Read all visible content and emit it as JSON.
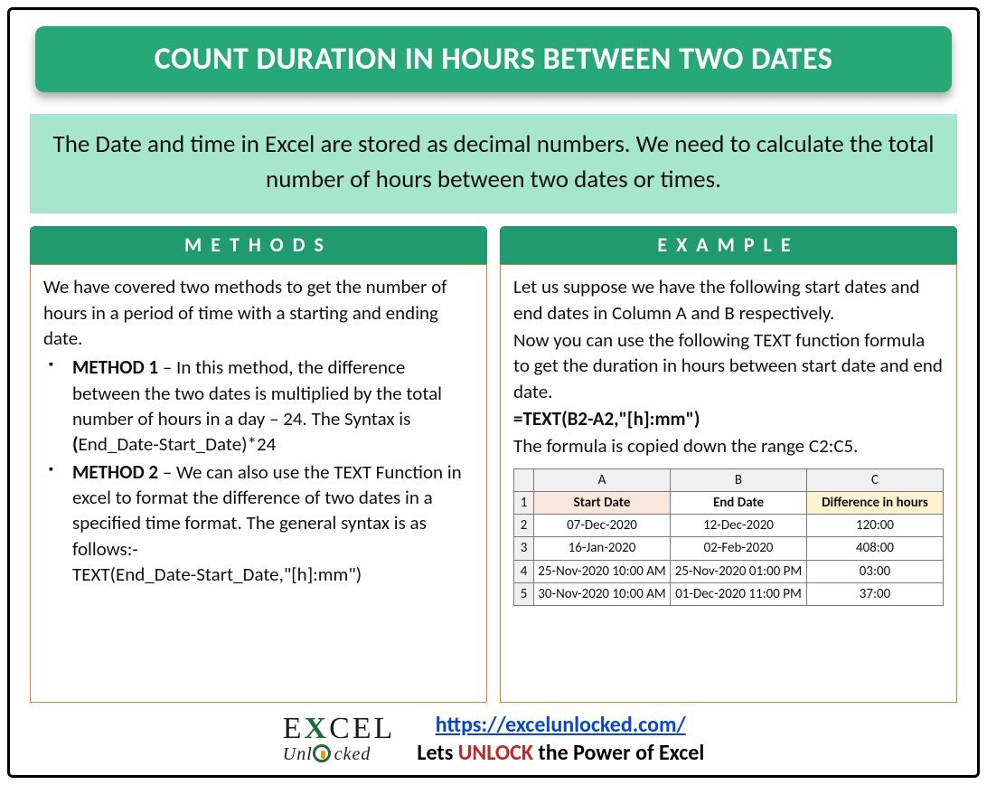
{
  "title": "COUNT DURATION IN HOURS BETWEEN TWO DATES",
  "intro": "The Date and time in Excel are stored as decimal numbers. We need to calculate the total number of hours between two dates or times.",
  "methods": {
    "heading": "METHODS",
    "lead": "We have covered two methods to get the number of hours in a period of time with a starting and ending date.",
    "m1_label": "METHOD 1",
    "m1_text": " – In this method, the difference between the two dates is multiplied by the total number of hours in a day – 24. The Syntax is",
    "m1_syntax_open": "(",
    "m1_syntax_rest": "End_Date-Start_Date)*24",
    "m2_label": "METHOD 2",
    "m2_text": " – We can also use the TEXT Function in excel to format the difference of two dates in a specified time format. The general syntax is as follows:-",
    "m2_syntax": "TEXT(End_Date-Start_Date,\"[h]:mm\")"
  },
  "example": {
    "heading": "EXAMPLE",
    "p1": "Let us suppose we have the following start dates and end dates in Column A and B respectively.",
    "p2": "Now you can use the following TEXT function formula to get the duration in hours between start date and end date.",
    "formula": "=TEXT(B2-A2,\"[h]:mm\")",
    "p3": "The formula is copied down the range C2:C5.",
    "table": {
      "col_letters": [
        "A",
        "B",
        "C"
      ],
      "headers": {
        "start": "Start Date",
        "end": "End Date",
        "diff": "Difference in hours"
      },
      "rows": [
        {
          "n": "2",
          "a": "07-Dec-2020",
          "b": "12-Dec-2020",
          "c": "120:00"
        },
        {
          "n": "3",
          "a": "16-Jan-2020",
          "b": "02-Feb-2020",
          "c": "408:00"
        },
        {
          "n": "4",
          "a": "25-Nov-2020 10:00 AM",
          "b": "25-Nov-2020 01:00 PM",
          "c": "03:00"
        },
        {
          "n": "5",
          "a": "30-Nov-2020 10:00 AM",
          "b": "01-Dec-2020 11:00 PM",
          "c": "37:00"
        }
      ]
    }
  },
  "footer": {
    "logo_top_e1": "E",
    "logo_top_x": "X",
    "logo_top_rest": "CEL",
    "logo_bottom_pre": "Unl",
    "logo_bottom_post": "cked",
    "url": "https://excelunlocked.com/",
    "tag_pre": "Lets ",
    "tag_unlock": "UNLOCK",
    "tag_post": " the Power of Excel"
  }
}
